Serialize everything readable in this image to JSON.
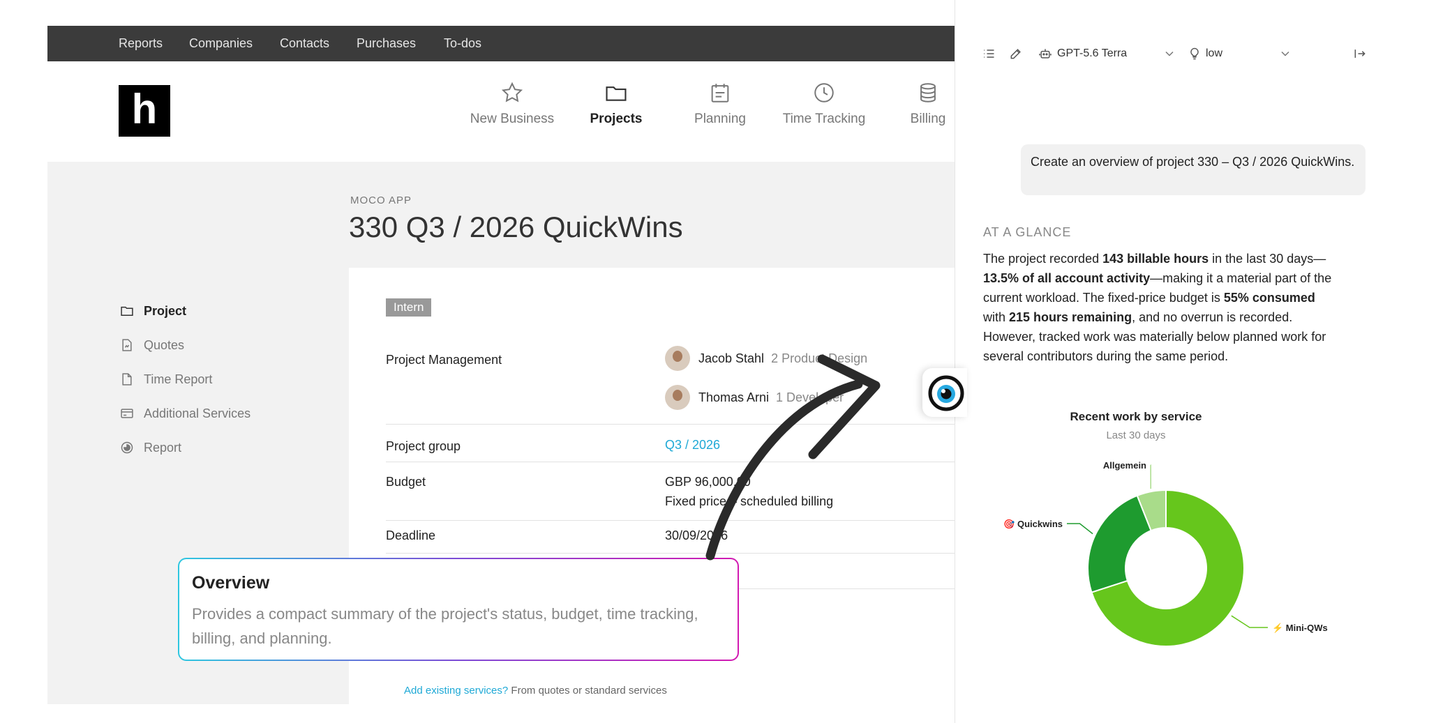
{
  "topnav": {
    "items": [
      "Reports",
      "Companies",
      "Contacts",
      "Purchases",
      "To-dos"
    ]
  },
  "logo": {
    "letter": "h"
  },
  "mainnav": {
    "items": [
      {
        "label": "New Business",
        "icon": "star-icon"
      },
      {
        "label": "Projects",
        "icon": "folder-icon",
        "active": true
      },
      {
        "label": "Planning",
        "icon": "calendar-icon"
      },
      {
        "label": "Time Tracking",
        "icon": "clock-icon"
      },
      {
        "label": "Billing",
        "icon": "database-icon"
      }
    ]
  },
  "page": {
    "crumb": "MOCO APP",
    "title": "330 Q3 / 2026 QuickWins"
  },
  "sidebar": {
    "items": [
      {
        "label": "Project",
        "icon": "folder-icon",
        "active": true
      },
      {
        "label": "Quotes",
        "icon": "document-icon"
      },
      {
        "label": "Time Report",
        "icon": "file-icon"
      },
      {
        "label": "Additional Services",
        "icon": "card-icon"
      },
      {
        "label": "Report",
        "icon": "report-icon"
      }
    ]
  },
  "project": {
    "badge": "Intern",
    "labels": {
      "management": "Project Management",
      "group": "Project group",
      "budget": "Budget",
      "deadline": "Deadline"
    },
    "people": [
      {
        "name": "Jacob Stahl",
        "role": "2 Product Design"
      },
      {
        "name": "Thomas Arni",
        "role": "1 Developer"
      }
    ],
    "group_value": "Q3 / 2026",
    "budget_amount": "GBP 96,000.00",
    "budget_type": "Fixed price – scheduled billing",
    "deadline_value": "30/09/2026",
    "footer_link": "Add existing services?",
    "footer_text": " From quotes or standard services"
  },
  "overview": {
    "title": "Overview",
    "text": "Provides a compact summary of the project's status, budget, time tracking, billing, and planning."
  },
  "chat": {
    "model": "GPT-5.6 Terra",
    "effort": "low",
    "user_message": "Create an overview of project 330 – Q3 / 2026 QuickWins.",
    "glance_heading": "AT A GLANCE",
    "glance": {
      "p1": "The project recorded ",
      "b1": "143 billable hours",
      "p2": " in the last 30 days—",
      "b2": "13.5% of all account activity",
      "p3": "—making it a material part of the current workload. The fixed-price budget is ",
      "b3": "55% consumed",
      "p4": " with ",
      "b4": "215 hours remaining",
      "p5": ", and no overrun is recorded. However, tracked work was materially below planned work for several contributors during the same period."
    }
  },
  "chart_data": {
    "type": "pie",
    "title": "Recent work by service",
    "subtitle": "Last 30 days",
    "categories": [
      "Mini-QWs",
      "Quickwins",
      "Allgemein"
    ],
    "values": [
      70,
      24,
      6
    ],
    "colors": [
      "#66c61c",
      "#1e9b2f",
      "#a9dc8a"
    ],
    "label_prefixes": [
      "⚡",
      "🎯",
      ""
    ]
  }
}
